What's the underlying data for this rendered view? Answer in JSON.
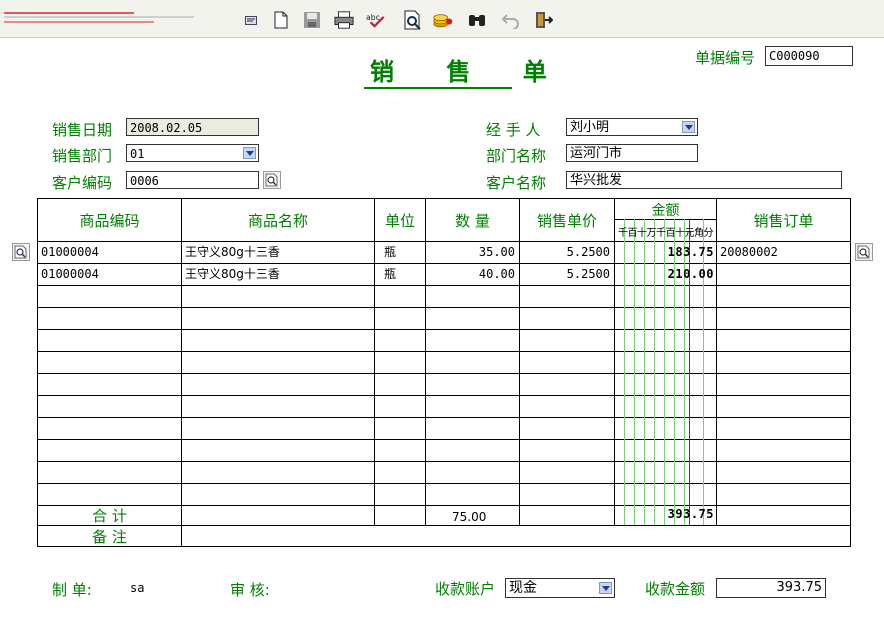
{
  "toolbar": {
    "icons": [
      "edit-icon",
      "new-document-icon",
      "save-icon",
      "print-icon",
      "spell-check-icon",
      "print-preview-icon",
      "coins-icon",
      "find-icon",
      "undo-icon",
      "exit-icon"
    ]
  },
  "form": {
    "title": "销 售 单",
    "doc_no_label": "单据编号",
    "doc_no_value": "C000090",
    "sale_date_label": "销售日期",
    "sale_date_value": "2008.02.05",
    "dept_label": "销售部门",
    "dept_value": "01",
    "customer_code_label": "客户编码",
    "customer_code_value": "0006",
    "handler_label": "经 手 人",
    "handler_value": "刘小明",
    "dept_name_label": "部门名称",
    "dept_name_value": "运河门市",
    "customer_name_label": "客户名称",
    "customer_name_value": "华兴批发"
  },
  "table": {
    "headers": {
      "code": "商品编码",
      "name": "商品名称",
      "unit": "单位",
      "qty": "数 量",
      "price": "销售单价",
      "amount": "金额",
      "amount_digits": "千百十万千百十元角分",
      "order": "销售订单"
    },
    "rows": [
      {
        "code": "01000004",
        "name": "王守义80g十三香",
        "unit": "瓶",
        "qty": "35.00",
        "price": "5.2500",
        "amount": "183.75",
        "order": "20080002"
      },
      {
        "code": "01000004",
        "name": "王守义80g十三香",
        "unit": "瓶",
        "qty": "40.00",
        "price": "5.2500",
        "amount": "210.00",
        "order": ""
      }
    ],
    "total_label": "合 计",
    "total_qty": "75.00",
    "total_amount": "393.75",
    "remark_label": "备 注"
  },
  "footer": {
    "maker_label": "制 单:",
    "maker_value": "sa",
    "review_label": "审 核:",
    "account_label": "收款账户",
    "account_value": "现金",
    "amount_label": "收款金额",
    "amount_value": "393.75"
  }
}
